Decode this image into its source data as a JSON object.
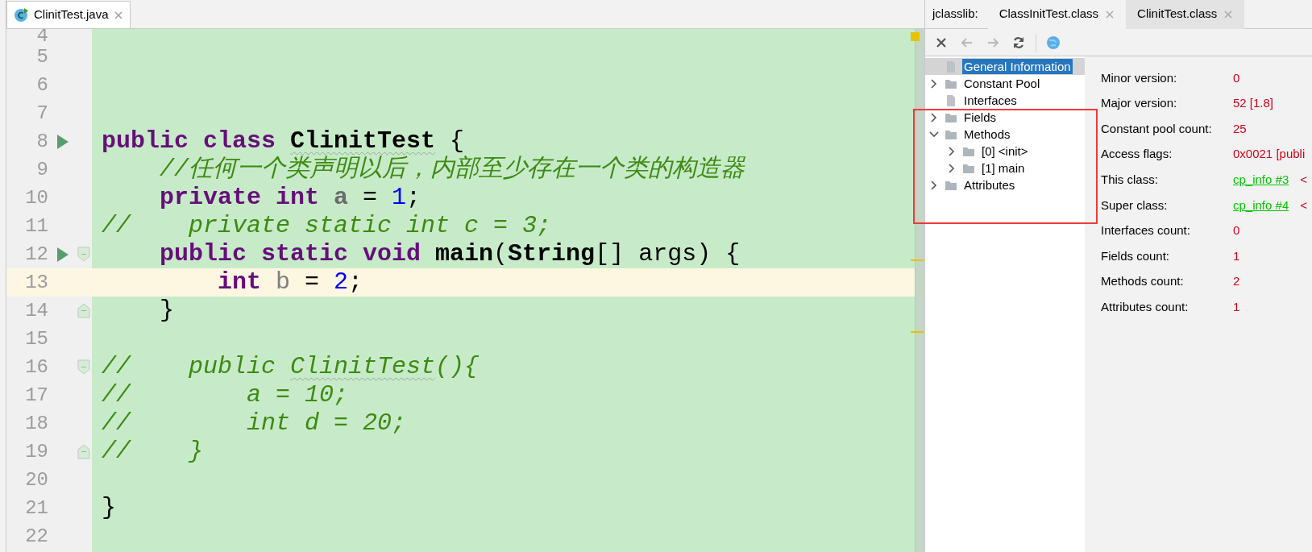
{
  "editor": {
    "tabs": [
      {
        "label": "ClinitTest.java",
        "selected": true
      }
    ],
    "lines": [
      {
        "number": "4"
      },
      {
        "number": "5"
      },
      {
        "number": "6"
      },
      {
        "number": "7"
      },
      {
        "number": "8",
        "run": true,
        "segments": [
          {
            "kind": "keyword",
            "text": "public class "
          },
          {
            "kind": "class-warn",
            "text": "ClinitTest"
          },
          {
            "kind": "plain",
            "text": " {"
          }
        ]
      },
      {
        "number": "9",
        "segments": [
          {
            "kind": "comment",
            "text": "    //任何一个类声明以后，内部至少存在一个类的构造器"
          }
        ]
      },
      {
        "number": "10",
        "segments": [
          {
            "kind": "keyword",
            "text": "    private int "
          },
          {
            "kind": "field",
            "text": "a"
          },
          {
            "kind": "plain",
            "text": " = "
          },
          {
            "kind": "number",
            "text": "1"
          },
          {
            "kind": "plain",
            "text": ";"
          }
        ]
      },
      {
        "number": "11",
        "segments": [
          {
            "kind": "comment",
            "text": "//    private static int c = 3;"
          }
        ]
      },
      {
        "number": "12",
        "run": true,
        "fold_start": true,
        "segments": [
          {
            "kind": "keyword",
            "text": "    public static void "
          },
          {
            "kind": "class",
            "text": "main"
          },
          {
            "kind": "plain",
            "text": "("
          },
          {
            "kind": "class",
            "text": "String"
          },
          {
            "kind": "plain",
            "text": "[] args) {"
          }
        ]
      },
      {
        "number": "13",
        "current": true,
        "segments": [
          {
            "kind": "keyword",
            "text": "        int "
          },
          {
            "kind": "unused",
            "text": "b"
          },
          {
            "kind": "plain",
            "text": " = "
          },
          {
            "kind": "number",
            "text": "2"
          },
          {
            "kind": "plain",
            "text": ";"
          }
        ]
      },
      {
        "number": "14",
        "fold_end": true,
        "segments": [
          {
            "kind": "plain",
            "text": "    }"
          }
        ]
      },
      {
        "number": "15"
      },
      {
        "number": "16",
        "fold_start": true,
        "segments": [
          {
            "kind": "comment",
            "text": "//    public "
          },
          {
            "kind": "comment-warn",
            "text": "ClinitTest"
          },
          {
            "kind": "comment",
            "text": "(){"
          }
        ]
      },
      {
        "number": "17",
        "segments": [
          {
            "kind": "comment",
            "text": "//        a = 10;"
          }
        ]
      },
      {
        "number": "18",
        "segments": [
          {
            "kind": "comment",
            "text": "//        int d = 20;"
          }
        ]
      },
      {
        "number": "19",
        "fold_end": true,
        "segments": [
          {
            "kind": "comment",
            "text": "//    }"
          }
        ]
      },
      {
        "number": "20"
      },
      {
        "number": "21",
        "segments": [
          {
            "kind": "plain",
            "text": "}"
          }
        ]
      },
      {
        "number": "22"
      }
    ]
  },
  "jclasslib": {
    "title": "jclasslib:",
    "tabs": [
      {
        "label": "ClassInitTest.class",
        "selected": false
      },
      {
        "label": "ClinitTest.class",
        "selected": true
      }
    ],
    "toolbar": [
      {
        "kind": "close",
        "disabled": false
      },
      {
        "kind": "back",
        "disabled": true
      },
      {
        "kind": "forward",
        "disabled": true
      },
      {
        "kind": "refresh",
        "disabled": false
      },
      {
        "kind": "globe"
      }
    ],
    "tree": [
      {
        "label": "General Information",
        "kind": "file",
        "selected": true
      },
      {
        "label": "Constant Pool",
        "kind": "folder",
        "selected": false,
        "expanded": false
      },
      {
        "label": "Interfaces",
        "kind": "file",
        "selected": false
      },
      {
        "label": "Fields",
        "kind": "folder",
        "selected": false,
        "expanded": false
      },
      {
        "label": "Methods",
        "kind": "folder",
        "selected": false,
        "expanded": true,
        "children": [
          {
            "label": "[0] <init>",
            "kind": "folder",
            "selected": false,
            "expanded": false
          },
          {
            "label": "[1] main",
            "kind": "folder",
            "selected": false,
            "expanded": false
          }
        ]
      },
      {
        "label": "Attributes",
        "kind": "folder",
        "selected": false,
        "expanded": false
      }
    ],
    "details": [
      {
        "label": "Minor version:",
        "value": "0"
      },
      {
        "label": "Major version:",
        "value": "52 [1.8]"
      },
      {
        "label": "Constant pool count:",
        "value": "25"
      },
      {
        "label": "Access flags:",
        "value": "0x0021 [publi"
      },
      {
        "label": "This class:",
        "value": "cp_info #3",
        "link": true,
        "suffix": "<"
      },
      {
        "label": "Super class:",
        "value": "cp_info #4",
        "link": true,
        "suffix": "<"
      },
      {
        "label": "Interfaces count:",
        "value": "0"
      },
      {
        "label": "Fields count:",
        "value": "1"
      },
      {
        "label": "Methods count:",
        "value": "2"
      },
      {
        "label": "Attributes count:",
        "value": "1"
      }
    ]
  }
}
